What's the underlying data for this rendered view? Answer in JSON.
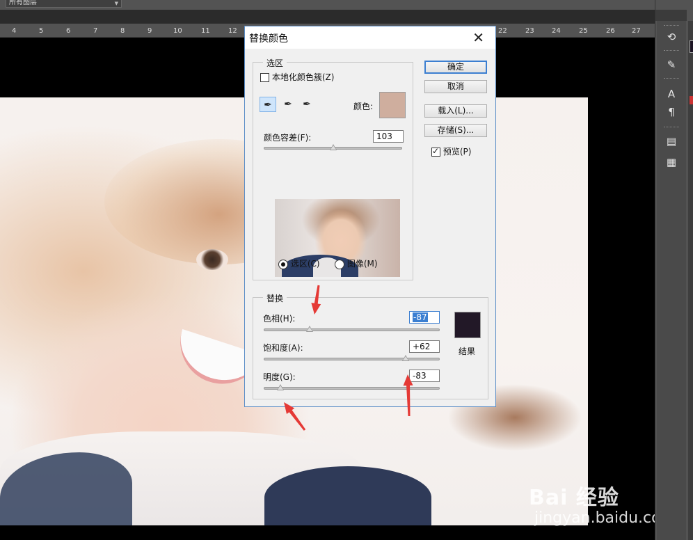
{
  "app": {
    "layer_select": "所有图层",
    "ruler_ticks": [
      "4",
      "5",
      "6",
      "7",
      "8",
      "9",
      "10",
      "11",
      "12",
      "22",
      "23",
      "24",
      "25",
      "26",
      "27"
    ]
  },
  "watermark": {
    "brand": "Bai 经验",
    "url": "jingyan.baidu.com"
  },
  "right_panel": {
    "collapse_glyph": "◂◂",
    "icons": [
      "history-icon",
      "brush-presets-icon",
      "character-icon",
      "paragraph-icon",
      "layer-comps-icon",
      "notes-icon"
    ]
  },
  "dialog": {
    "title": "替换颜色",
    "close_glyph": "✕",
    "selection_group": {
      "label": "选区",
      "localized_clusters": {
        "label": "本地化颜色簇(Z)",
        "checked": false
      },
      "color_label": "颜色:",
      "color_swatch": "#cfae9e",
      "fuzziness": {
        "label": "颜色容差(F):",
        "value": "103",
        "fraction": 0.5
      },
      "radio_selection": {
        "label": "选区(C)",
        "checked": true
      },
      "radio_image": {
        "label": "图像(M)",
        "checked": false
      }
    },
    "buttons": {
      "ok": "确定",
      "cancel": "取消",
      "load": "载入(L)...",
      "save": "存储(S)..."
    },
    "preview": {
      "label": "预览(P)",
      "checked": true
    },
    "replacement_group": {
      "label": "替换",
      "hue": {
        "label": "色相(H):",
        "value": "-87",
        "fraction": 0.26
      },
      "saturation": {
        "label": "饱和度(A):",
        "value": "+62",
        "fraction": 0.81
      },
      "lightness": {
        "label": "明度(G):",
        "value": "-83",
        "fraction": 0.09
      },
      "result_label": "结果",
      "result_color": "#221827"
    }
  },
  "colors": {
    "annotation_arrow": "#e53935",
    "dialog_border": "#5a8dc7"
  }
}
